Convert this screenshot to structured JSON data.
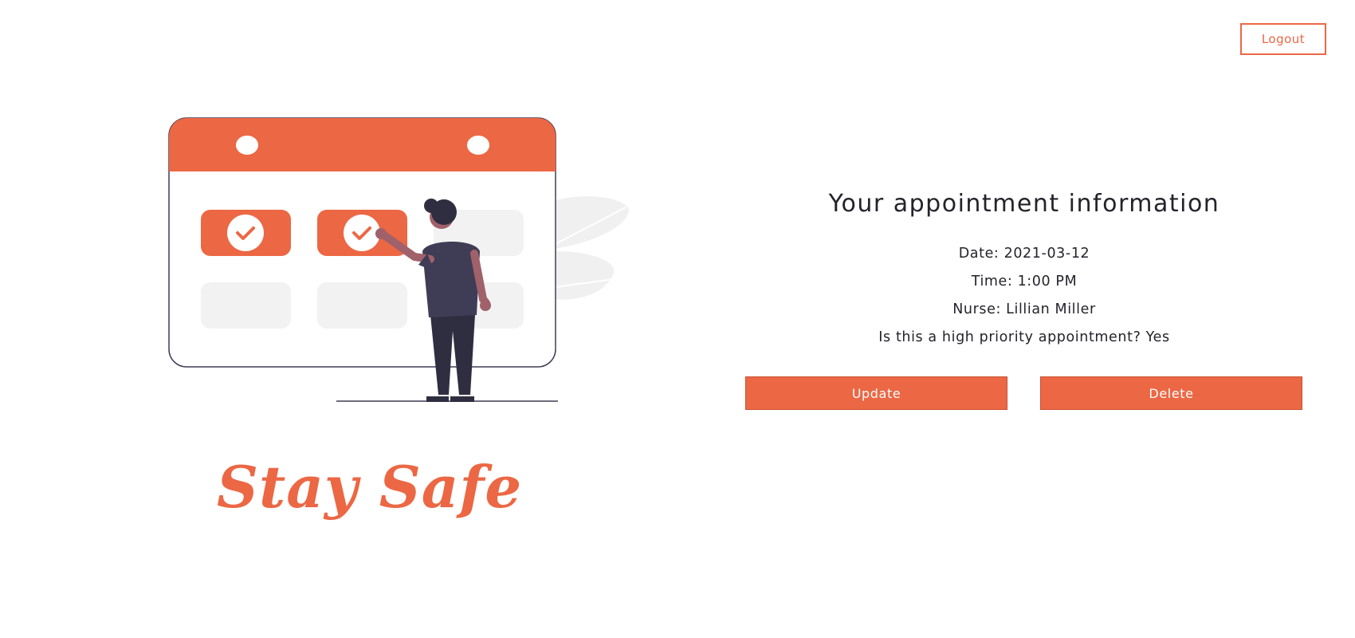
{
  "header": {
    "logout_label": "Logout"
  },
  "illustration": {
    "tagline": "Stay Safe"
  },
  "appointment": {
    "title": "Your appointment information",
    "date_line": "Date: 2021-03-12",
    "time_line": "Time: 1:00 PM",
    "nurse_line": "Nurse: Lillian Miller",
    "priority_line": "Is this a high priority appointment? Yes"
  },
  "actions": {
    "update_label": "Update",
    "delete_label": "Delete"
  },
  "colors": {
    "accent": "#ec6744",
    "text": "#23232b",
    "muted_tile": "#f2f2f2",
    "figure_dark": "#3f3d56"
  }
}
